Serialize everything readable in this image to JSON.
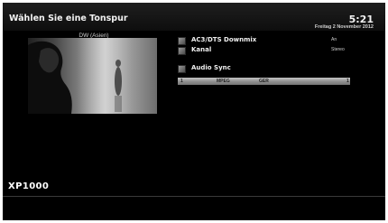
{
  "header": {
    "title": "Wählen Sie eine Tonspur",
    "time": "5:21",
    "date": "Freitag 2 November 2012"
  },
  "preview": {
    "channel": "DW (Asien)"
  },
  "options": [
    {
      "label": "AC3/DTS Downmix",
      "value": "An",
      "icon": "checkbox-icon"
    },
    {
      "label": "Kanal",
      "value": "Stereo",
      "icon": "checkbox-icon"
    },
    {
      "label": "Audio Sync",
      "value": "",
      "icon": "checkbox-icon"
    }
  ],
  "tracks": [
    {
      "number": "1",
      "codec": "MPEG",
      "language": "GER",
      "index": "1"
    }
  ],
  "footer": {
    "model": "XP1000"
  }
}
